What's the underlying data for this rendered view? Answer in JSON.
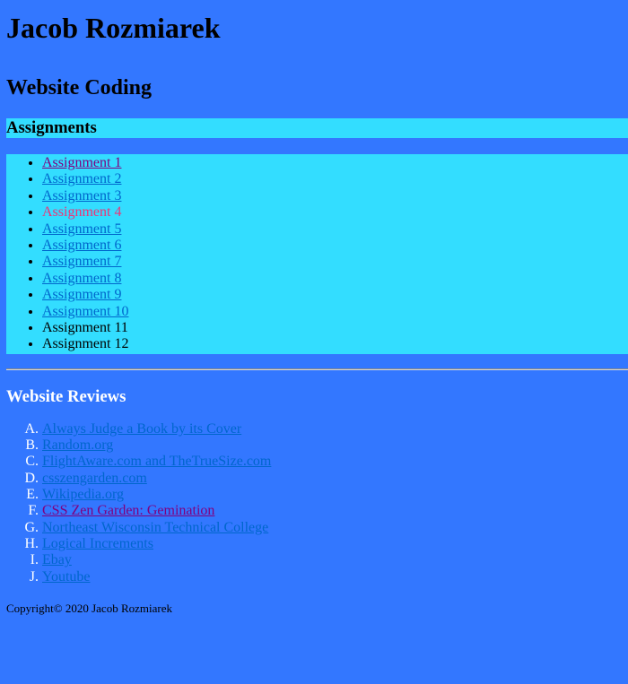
{
  "header": {
    "name": "Jacob Rozmiarek",
    "subtitle": "Website Coding"
  },
  "assignments": {
    "heading": "Assignments",
    "items": [
      {
        "label": "Assignment 1",
        "state": "visited"
      },
      {
        "label": "Assignment 2",
        "state": "link"
      },
      {
        "label": "Assignment 3",
        "state": "link"
      },
      {
        "label": "Assignment 4",
        "state": "hover"
      },
      {
        "label": "Assignment 5",
        "state": "link"
      },
      {
        "label": "Assignment 6",
        "state": "link"
      },
      {
        "label": "Assignment 7",
        "state": "link"
      },
      {
        "label": "Assignment 8",
        "state": "link"
      },
      {
        "label": "Assignment 9",
        "state": "link"
      },
      {
        "label": "Assignment 10",
        "state": "link"
      },
      {
        "label": "Assignment 11",
        "state": "plain"
      },
      {
        "label": "Assignment 12",
        "state": "plain"
      }
    ]
  },
  "reviews": {
    "heading": "Website Reviews",
    "items": [
      {
        "label": "Always Judge a Book by its Cover",
        "state": "link"
      },
      {
        "label": "Random.org",
        "state": "link"
      },
      {
        "label": "FlightAware.com and TheTrueSize.com",
        "state": "link"
      },
      {
        "label": "csszengarden.com",
        "state": "link"
      },
      {
        "label": "Wikipedia.org",
        "state": "link"
      },
      {
        "label": "CSS Zen Garden: Gemination",
        "state": "visited"
      },
      {
        "label": "Northeast Wisconsin Technical College",
        "state": "link"
      },
      {
        "label": "Logical Increments",
        "state": "link"
      },
      {
        "label": "Ebay",
        "state": "link"
      },
      {
        "label": "Youtube",
        "state": "link"
      }
    ]
  },
  "footer": {
    "copyright": "Copyright© 2020 Jacob Rozmiarek"
  },
  "colors": {
    "background": "#3377ff",
    "section_bg": "#33ddff",
    "link": "#0066cc",
    "visited": "#800080",
    "hover": "#ee3377"
  }
}
